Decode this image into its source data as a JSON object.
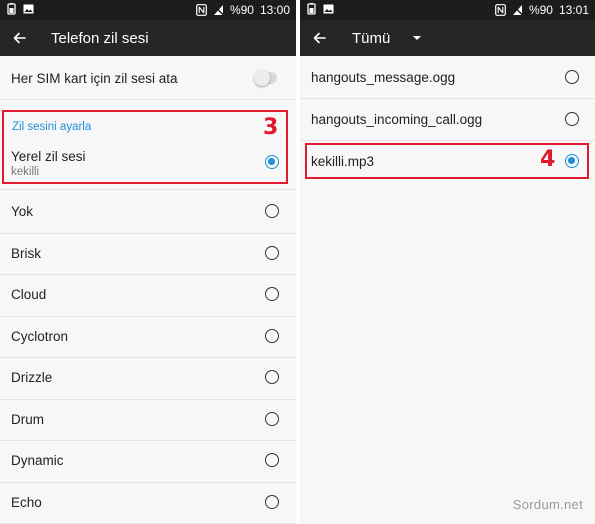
{
  "left": {
    "status": {
      "signal": "%90",
      "time": "13:00"
    },
    "toolbar": {
      "title": "Telefon zil sesi"
    },
    "sim_row": {
      "label": "Her SIM kart için zil sesi ata"
    },
    "section_header": "Zil sesini ayarla",
    "current": {
      "title": "Yerel zil sesi",
      "subtitle": "kekilli"
    },
    "step_label": "3",
    "ringtones": [
      "Yok",
      "Brisk",
      "Cloud",
      "Cyclotron",
      "Drizzle",
      "Drum",
      "Dynamic",
      "Echo"
    ]
  },
  "right": {
    "status": {
      "signal": "%90",
      "time": "13:01"
    },
    "toolbar": {
      "title": "Tümü"
    },
    "files": [
      "hangouts_message.ogg",
      "hangouts_incoming_call.ogg",
      "kekilli.mp3"
    ],
    "selected_index": 2,
    "step_label": "4"
  },
  "watermark": "Sordum.net",
  "colors": {
    "accent": "#1e90d8",
    "highlight": "#e0192b",
    "toolbar": "#262626",
    "statusbar": "#1c1c1c"
  },
  "icons": [
    "battery-icon",
    "image-icon",
    "nfc-icon",
    "no-signal-icon",
    "back-arrow-icon",
    "dropdown-icon",
    "radio-icon"
  ]
}
